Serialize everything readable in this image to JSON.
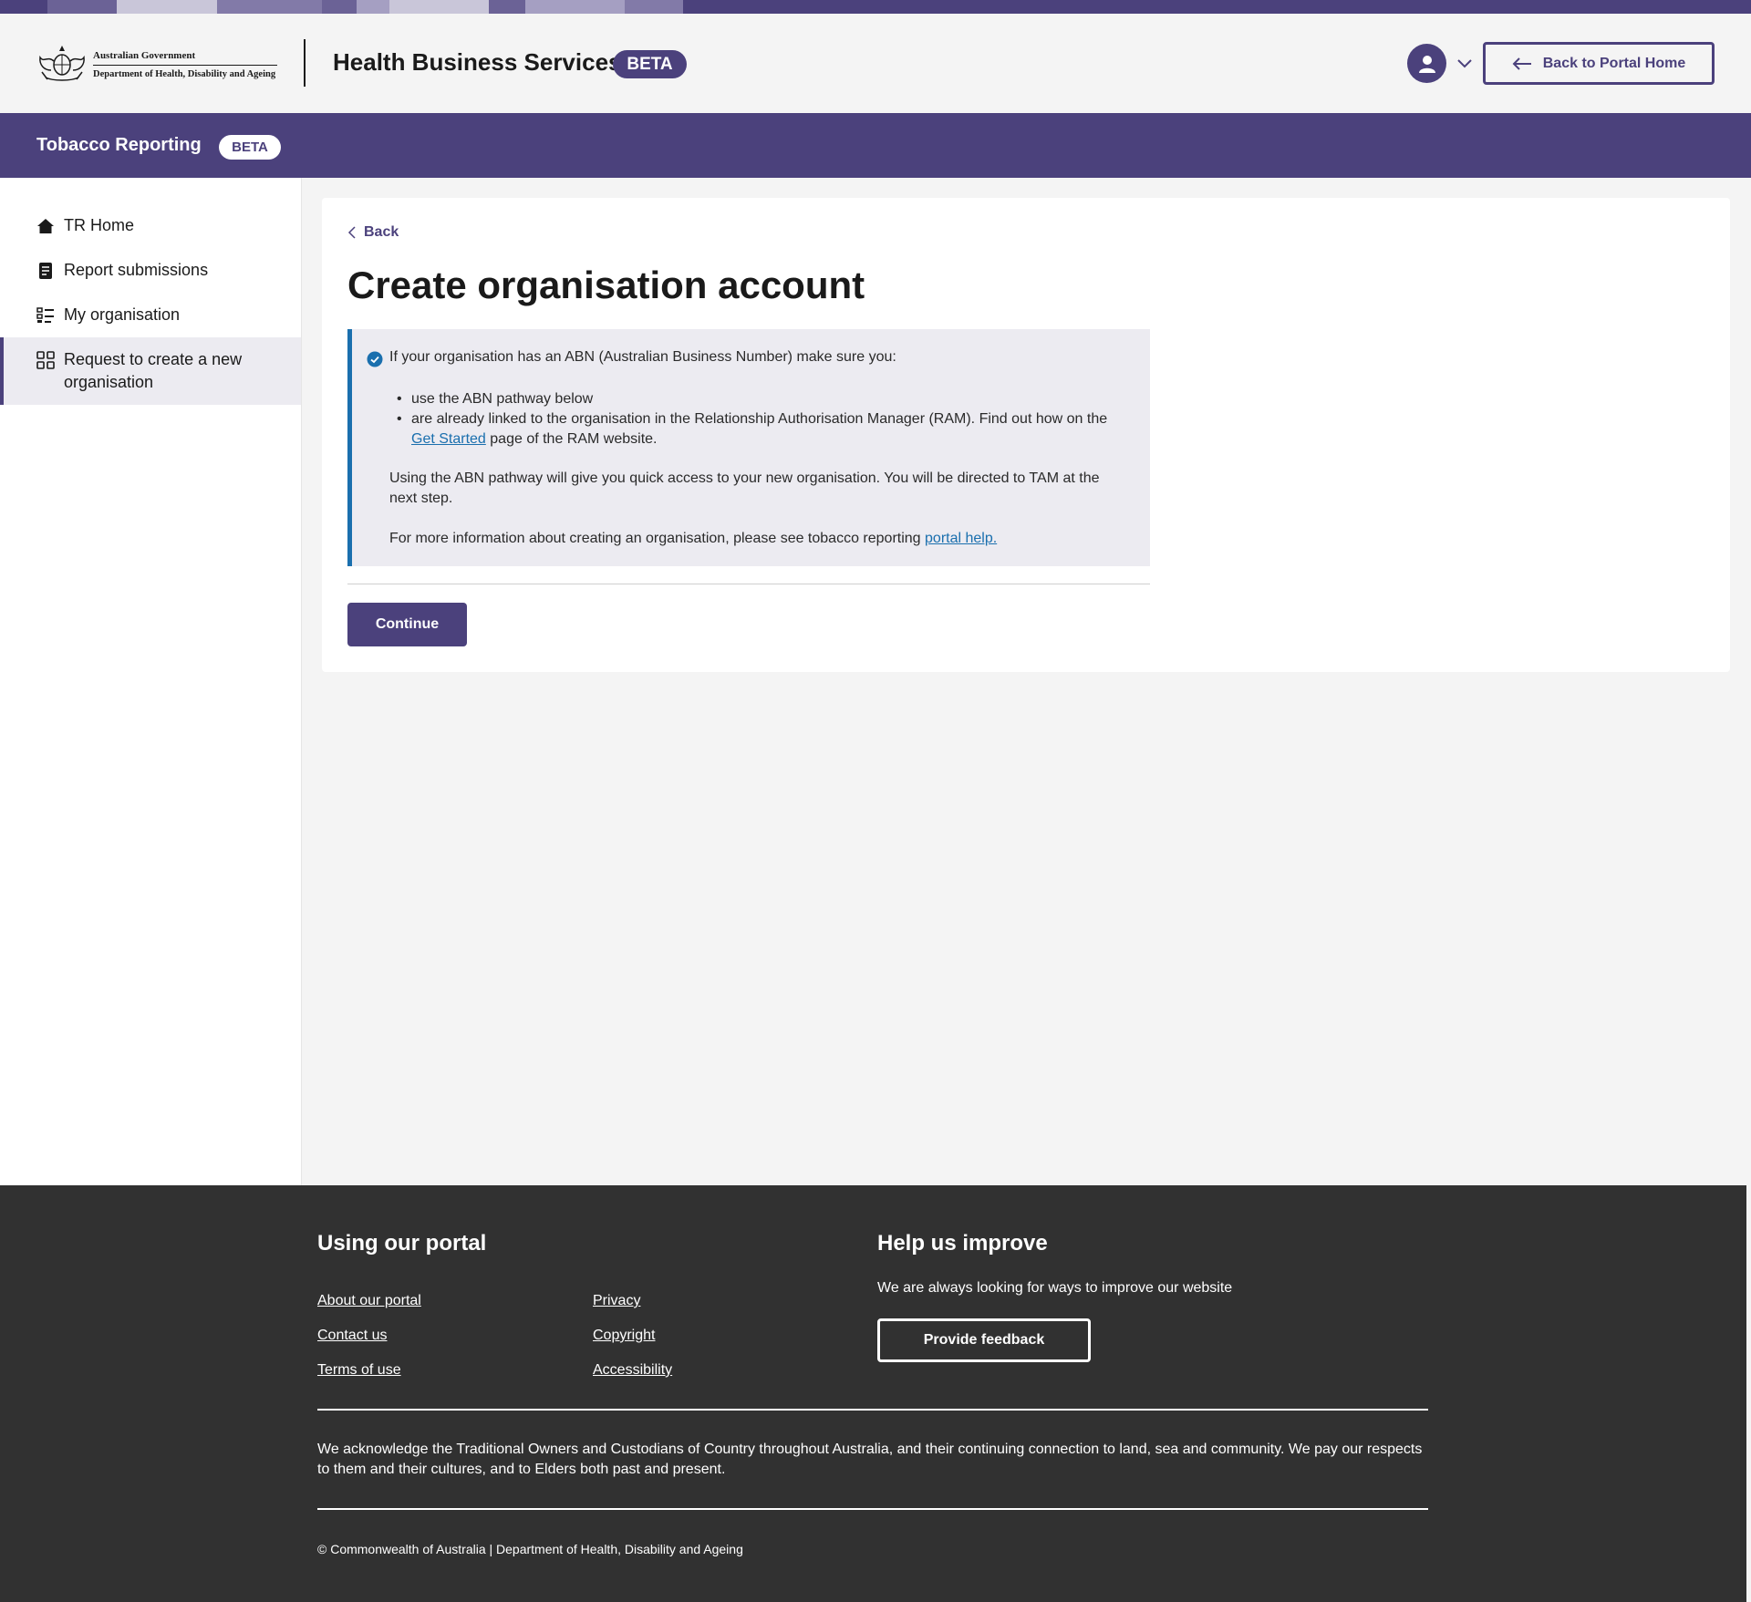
{
  "header": {
    "gov_line1": "Australian Government",
    "gov_line2": "Department of Health, Disability and Ageing",
    "site_title": "Health Business Services",
    "beta": "BETA",
    "portal_button": "Back to Portal Home"
  },
  "service_bar": {
    "name": "Tobacco Reporting",
    "beta": "BETA"
  },
  "sidebar": {
    "items": [
      {
        "label": "TR Home",
        "icon": "home-icon"
      },
      {
        "label": "Report submissions",
        "icon": "document-icon"
      },
      {
        "label": "My organisation",
        "icon": "checklist-icon"
      },
      {
        "label": "Request to create a new organisation",
        "icon": "grid-icon",
        "active": true
      }
    ]
  },
  "main": {
    "back": "Back",
    "title": "Create organisation account",
    "callout": {
      "lead": "If your organisation has an ABN (Australian Business Number) make sure you:",
      "bullet1": "use the ABN pathway below",
      "bullet2_before": "are already linked to the organisation in the Relationship Authorisation Manager (RAM). Find out how on the ",
      "bullet2_link": "Get Started",
      "bullet2_after": " page of the RAM website.",
      "para1": "Using the ABN pathway will give you quick access to your new organisation. You will be directed to TAM at the next step.",
      "para2_before": "For more information about creating an organisation, please see tobacco reporting ",
      "para2_link": "portal help."
    },
    "continue": "Continue"
  },
  "footer": {
    "using_heading": "Using our portal",
    "links_col1": [
      "About our portal",
      "Contact us",
      "Terms of use"
    ],
    "links_col2": [
      "Privacy",
      "Copyright",
      "Accessibility"
    ],
    "help_heading": "Help us improve",
    "help_text": "We are always looking for ways to improve our website",
    "feedback_button": "Provide feedback",
    "acknowledgement": "We acknowledge the Traditional Owners and Custodians of Country throughout Australia, and their continuing connection to land, sea and community. We pay our respects to them and their cultures, and to Elders both past and present.",
    "copyright": "© Commonwealth of Australia | Department of Health, Disability and Ageing"
  },
  "colors": {
    "brand": "#4b417c",
    "link": "#1a6fae",
    "footer_bg": "#313131",
    "page_bg": "#f4f4f4",
    "callout_bg": "#ecebf1"
  }
}
